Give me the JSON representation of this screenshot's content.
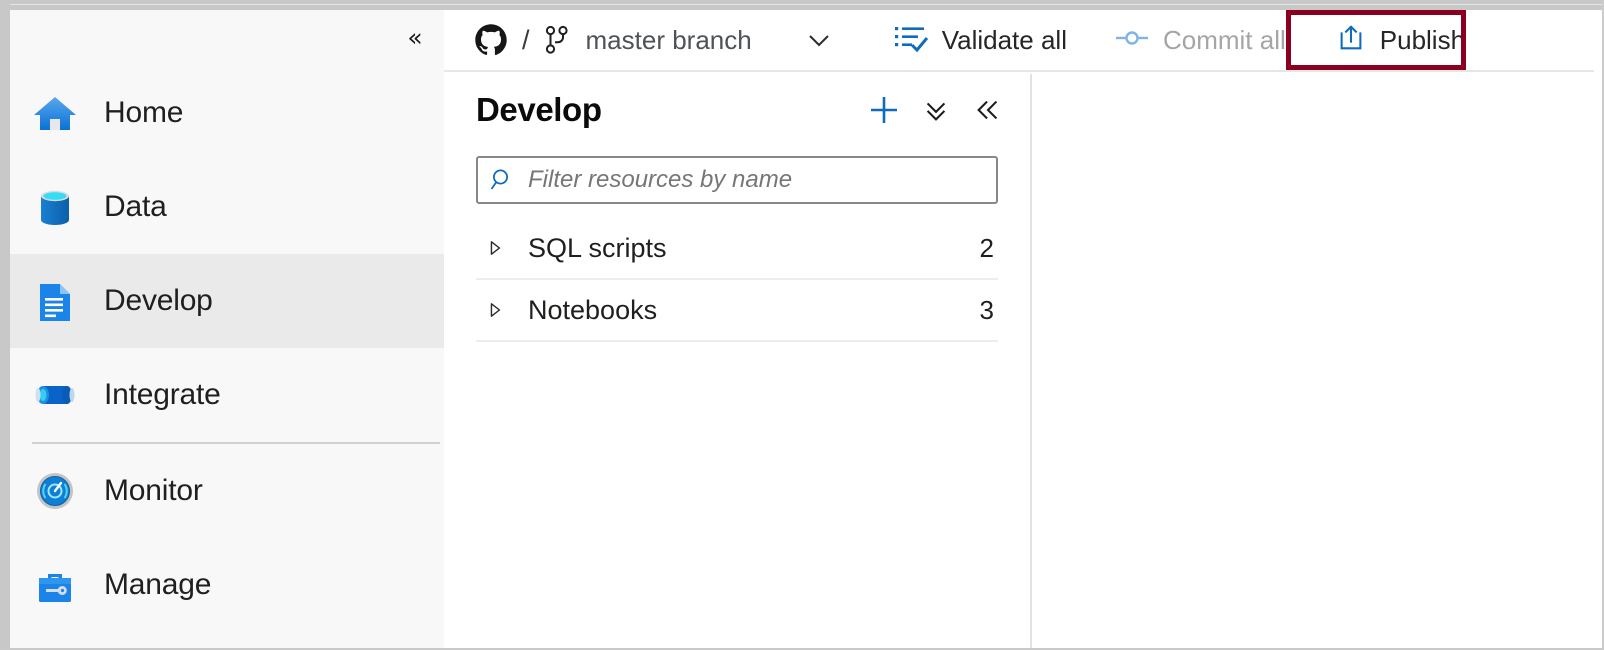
{
  "window": {
    "frame_color": "#c8c8c8"
  },
  "sidebar": {
    "collapse_icon": "chevron-double-left",
    "items": [
      {
        "label": "Home",
        "icon": "home-icon",
        "selected": false
      },
      {
        "label": "Data",
        "icon": "database-icon",
        "selected": false
      },
      {
        "label": "Develop",
        "icon": "document-icon",
        "selected": true
      },
      {
        "label": "Integrate",
        "icon": "pipeline-icon",
        "selected": false
      },
      {
        "label": "Monitor",
        "icon": "gauge-icon",
        "selected": false
      },
      {
        "label": "Manage",
        "icon": "toolbox-icon",
        "selected": false
      }
    ]
  },
  "toolbar": {
    "repo_icon": "github-icon",
    "separator": "/",
    "branch_icon": "git-branch-icon",
    "branch_label": "master branch",
    "branch_caret_icon": "chevron-down-icon",
    "validate_all_label": "Validate all",
    "validate_all_icon": "checklist-icon",
    "commit_all_label": "Commit all",
    "commit_all_icon": "commit-icon",
    "commit_all_disabled": true,
    "publish_label": "Publish",
    "publish_icon": "publish-upload-icon",
    "publish_highlight_color": "#8b0020"
  },
  "develop_panel": {
    "title": "Develop",
    "actions": [
      {
        "name": "add-new-resource",
        "icon": "plus-icon"
      },
      {
        "name": "actions-menu",
        "icon": "chevron-double-down-icon"
      },
      {
        "name": "collapse-panel",
        "icon": "chevron-double-left-icon"
      }
    ],
    "filter": {
      "icon": "search-icon",
      "placeholder": "Filter resources by name",
      "value": ""
    },
    "tree": [
      {
        "label": "SQL scripts",
        "count": "2",
        "expanded": false
      },
      {
        "label": "Notebooks",
        "count": "3",
        "expanded": false
      }
    ]
  },
  "canvas": {
    "content": ""
  }
}
